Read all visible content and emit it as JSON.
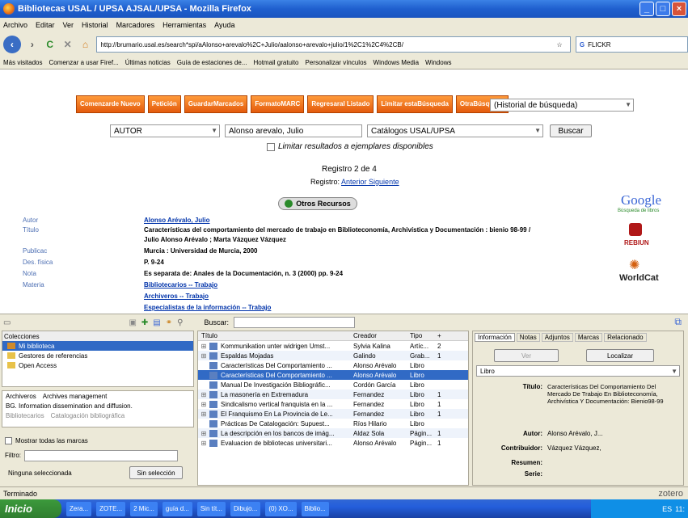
{
  "window": {
    "title": "Bibliotecas USAL / UPSA AJSAL/UPSA - Mozilla Firefox"
  },
  "menu": [
    "Archivo",
    "Editar",
    "Ver",
    "Historial",
    "Marcadores",
    "Herramientas",
    "Ayuda"
  ],
  "nav": {
    "url": "http://brumario.usal.es/search*spi/aAlonso+arevalo%2C+Julio/aalonso+arevalo+julio/1%2C1%2C4%2CB/",
    "search_value": "FLICKR"
  },
  "bookmarks": [
    "Más visitados",
    "Comenzar a usar Firef...",
    "Últimas noticias",
    "Guía de estaciones de...",
    "Hotmail gratuito",
    "Personalizar vínculos",
    "Windows Media",
    "Windows"
  ],
  "opac": {
    "buttons": [
      {
        "label1": "Comenzar",
        "label2": "de Nuevo"
      },
      {
        "label1": "Petición",
        "label2": ""
      },
      {
        "label1": "Guardar",
        "label2": "Marcados"
      },
      {
        "label1": "Formato",
        "label2": "MARC"
      },
      {
        "label1": "Regresar",
        "label2": "al Listado"
      },
      {
        "label1": "Limitar esta",
        "label2": "Búsqueda"
      },
      {
        "label1": "Otra",
        "label2": "Búsqueda"
      }
    ],
    "history_select": "(Historial de búsqueda)",
    "search_field": "AUTOR",
    "search_value": "Alonso arevalo, Julio",
    "catalog": "Catálogos USAL/UPSA",
    "search_button": "Buscar",
    "limit_checkbox": "Limitar resultados a ejemplares disponibles",
    "record_count": "Registro 2 de 4",
    "record_nav_prefix": "Registro:",
    "record_nav_link": "Anterior Siguiente",
    "otros_recursos": "Otros Recursos",
    "google": "Google",
    "google_sub": "Búsqueda de libros",
    "rebiun": "REBIUN",
    "worldcat": "WorldCat",
    "fields": [
      {
        "label": "Autor",
        "value": "Alonso Arévalo, Julio",
        "link": true
      },
      {
        "label": "Título",
        "value": "Características del comportamiento del mercado de trabajo en Biblioteconomía, Archivística y Documentación : bienio 98-99 /",
        "link": false
      },
      {
        "label": "",
        "value": "Julio Alonso Arévalo ; Marta Vázquez Vázquez",
        "link": false
      },
      {
        "label": "Publicac",
        "value": "Murcia : Universidad de Murcia, 2000",
        "link": false
      },
      {
        "label": "Des. física",
        "value": "P. 9-24",
        "link": false
      },
      {
        "label": "Nota",
        "value": "Es separata de: Anales de la Documentación, n. 3 (2000) pp. 9-24",
        "link": false
      },
      {
        "label": "Materia",
        "value": "Bibliotecarios -- Trabajo",
        "link": true
      },
      {
        "label": "",
        "value": "Archiveros -- Trabajo",
        "link": true
      },
      {
        "label": "",
        "value": "Especialistas de la información -- Trabajo",
        "link": true
      }
    ]
  },
  "zotero": {
    "search_label": "Buscar:",
    "collections_header": "Colecciones",
    "collections": [
      "Mi biblioteca",
      "Gestores de referencias",
      "Open Access"
    ],
    "tags": [
      "Archiveros",
      "Archives management",
      "BG. Information dissemination and diffusion.",
      "Bibliotecarios",
      "Catalogación bibliográfica"
    ],
    "show_all_tags": "Mostrar todas las marcas",
    "filter_label": "Filtro:",
    "none_selected": "Ninguna seleccionada",
    "deselect_button": "Sin selección",
    "columns": [
      "Título",
      "Creador",
      "Tipo",
      "+"
    ],
    "items": [
      {
        "title": "Kommunikation unter widrigen Umst...",
        "creator": "Sylvia Kalina",
        "type": "Artíc...",
        "n": "2"
      },
      {
        "title": "Espaldas Mojadas",
        "creator": "Galindo",
        "type": "Grab...",
        "n": "1"
      },
      {
        "title": "Características Del Comportamiento ...",
        "creator": "Alonso Arévalo",
        "type": "Libro",
        "n": ""
      },
      {
        "title": "Características Del Comportamiento ...",
        "creator": "Alonso Arévalo",
        "type": "Libro",
        "n": ""
      },
      {
        "title": "Manual De Investigación Bibliográfic...",
        "creator": "Cordón García",
        "type": "Libro",
        "n": ""
      },
      {
        "title": "La masonería en Extremadura",
        "creator": "Fernandez",
        "type": "Libro",
        "n": "1"
      },
      {
        "title": "Sindicalismo vertical franquista en la ...",
        "creator": "Fernandez",
        "type": "Libro",
        "n": "1"
      },
      {
        "title": "El Franquismo En La Provincia de Le...",
        "creator": "Fernandez",
        "type": "Libro",
        "n": "1"
      },
      {
        "title": "Prácticas De Catalogación: Supuest...",
        "creator": "Ríos Hilario",
        "type": "Libro",
        "n": ""
      },
      {
        "title": "La descripción en los bancos de imág...",
        "creator": "Aldaz Sola",
        "type": "Págin...",
        "n": "1"
      },
      {
        "title": "Evaluacion de bibliotecas universitari...",
        "creator": "Alonso Arévalo",
        "type": "Págin...",
        "n": "1"
      }
    ],
    "tabs": [
      "Información",
      "Notas",
      "Adjuntos",
      "Marcas",
      "Relacionado"
    ],
    "ver_button": "Ver",
    "localizar_button": "Localizar",
    "item_type": "Libro",
    "info": [
      {
        "label": "Título:",
        "value": "Características Del Comportamiento Del Mercado De Trabajo En Biblioteconomía, Archivística Y Documentación: Bienio98-99"
      },
      {
        "label": "Autor:",
        "value": "Alonso Arévalo,  J..."
      },
      {
        "label": "Contribuidor:",
        "value": "Vázquez Vázquez,"
      },
      {
        "label": "Resumen:",
        "value": ""
      },
      {
        "label": "Serie:",
        "value": ""
      }
    ]
  },
  "status": {
    "text": "Terminado",
    "zotero": "zotero"
  },
  "taskbar": {
    "start": "Inicio",
    "items": [
      "Zera...",
      "ZOTE...",
      "2 Mic...",
      "guía d...",
      "Sin tít...",
      "Dibujo...",
      "(0) XO...",
      "Biblio..."
    ],
    "tray": "ES",
    "clock": "11:"
  }
}
